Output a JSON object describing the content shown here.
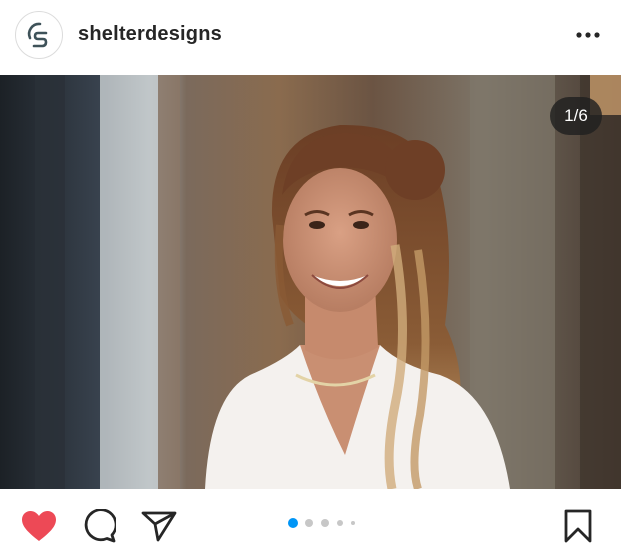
{
  "post": {
    "username": "shelterdesigns",
    "more_icon": "more-horizontal-icon",
    "avatar_icon": "shelterdesigns-logo",
    "counter": "1/6",
    "photo_description": "",
    "liked": true,
    "current_slide": 1,
    "total_slides": 6
  },
  "colors": {
    "like": "#ed4956",
    "active_dot": "#0095f6",
    "inactive_dot": "#c7c7c7",
    "text": "#262626"
  },
  "actions": {
    "like_icon": "heart-filled-icon",
    "comment_icon": "comment-icon",
    "share_icon": "send-icon",
    "save_icon": "bookmark-icon"
  }
}
